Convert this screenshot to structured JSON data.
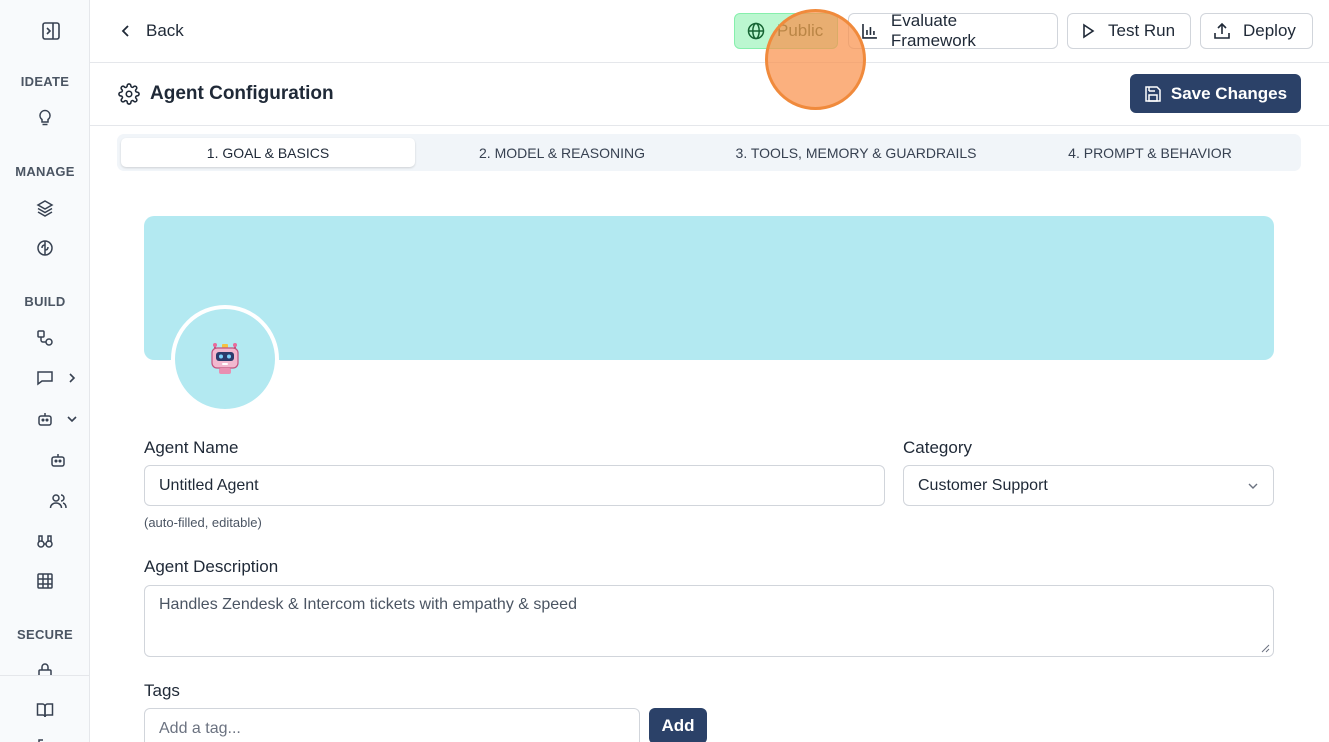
{
  "sidebar": {
    "sections": {
      "ideate": "IDEATE",
      "manage": "MANAGE",
      "build": "BUILD",
      "secure": "SECURE"
    }
  },
  "topbar": {
    "back_label": "Back",
    "public_label": "Public",
    "evaluate_label": "Evaluate Framework",
    "test_run_label": "Test Run",
    "deploy_label": "Deploy"
  },
  "config": {
    "title": "Agent Configuration",
    "save_label": "Save Changes"
  },
  "tabs": [
    {
      "label": "1. GOAL & BASICS",
      "active": true
    },
    {
      "label": "2. MODEL & REASONING",
      "active": false
    },
    {
      "label": "3. TOOLS, MEMORY & GUARDRAILS",
      "active": false
    },
    {
      "label": "4. PROMPT & BEHAVIOR",
      "active": false
    }
  ],
  "form": {
    "agent_name_label": "Agent Name",
    "agent_name_value": "Untitled Agent",
    "agent_name_hint": "(auto-filled, editable)",
    "category_label": "Category",
    "category_value": "Customer Support",
    "description_label": "Agent Description",
    "description_value": "Handles Zendesk & Intercom tickets with empathy & speed",
    "tags_label": "Tags",
    "tags_placeholder": "Add a tag...",
    "add_label": "Add"
  },
  "colors": {
    "primary": "#2b4168",
    "banner": "#b3e9f1",
    "public_bg": "#bbf7d0"
  }
}
